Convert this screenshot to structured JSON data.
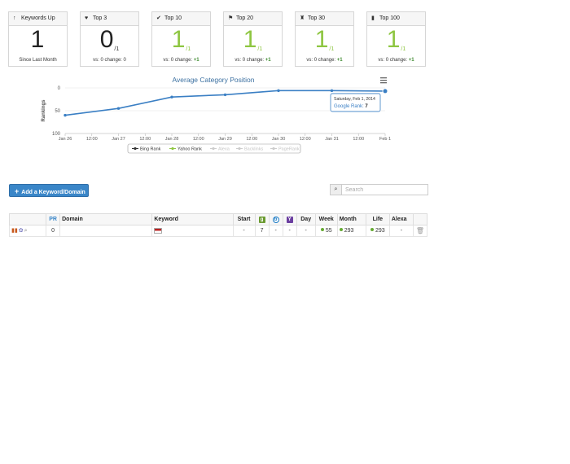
{
  "cards": [
    {
      "icon": "↑",
      "icon_name": "arrow-up-icon",
      "title": "Keywords Up",
      "value": "1",
      "denom": "",
      "footer_prefix": "Since Last Month",
      "footer_change": ""
    },
    {
      "icon": "♥",
      "icon_name": "heart-icon",
      "title": "Top 3",
      "value": "0",
      "denom": "/1",
      "footer_prefix": "vs: 0 change: 0",
      "footer_change": ""
    },
    {
      "icon": "✔",
      "icon_name": "check-icon",
      "title": "Top 10",
      "value": "1",
      "denom": "/1",
      "footer_prefix": "vs: 0 change:",
      "footer_change": "+1"
    },
    {
      "icon": "⚑",
      "icon_name": "bookmark-icon",
      "title": "Top 20",
      "value": "1",
      "denom": "/1",
      "footer_prefix": "vs: 0 change:",
      "footer_change": "+1"
    },
    {
      "icon": "♜",
      "icon_name": "tower-icon",
      "title": "Top 30",
      "value": "1",
      "denom": "/1",
      "footer_prefix": "vs: 0 change:",
      "footer_change": "+1"
    },
    {
      "icon": "▮",
      "icon_name": "bar-chart-icon",
      "title": "Top 100",
      "value": "1",
      "denom": "/1",
      "footer_prefix": "vs: 0 change:",
      "footer_change": "+1"
    }
  ],
  "chart_data": {
    "type": "line",
    "title": "Average Category Position",
    "ylabel": "Rankings",
    "ylim": [
      100,
      0
    ],
    "yticks": [
      "0",
      "50",
      "100"
    ],
    "x_ticks": [
      "Jan 26",
      "12:00",
      "Jan 27",
      "12:00",
      "Jan 28",
      "12:00",
      "Jan 29",
      "12:00",
      "Jan 30",
      "12:00",
      "Jan 31",
      "12:00",
      "Feb 1"
    ],
    "series": [
      {
        "name": "Google Rank",
        "x": [
          "Jan 26",
          "Jan 27",
          "Jan 28",
          "Jan 29",
          "Jan 30",
          "Jan 31",
          "Feb 1"
        ],
        "values": [
          60,
          45,
          20,
          15,
          6,
          6,
          7
        ],
        "color": "#3a7fc4"
      }
    ],
    "legend": [
      {
        "name": "Bing Rank",
        "active": true
      },
      {
        "name": "Yahoo Rank",
        "active": true
      },
      {
        "name": "Alexa",
        "active": false
      },
      {
        "name": "Backlinks",
        "active": false
      },
      {
        "name": "PageRank",
        "active": false
      }
    ],
    "tooltip": {
      "date": "Saturday, Feb 1, 2014",
      "label": "Google Rank:",
      "value": "7"
    }
  },
  "add_button": "Add a Keyword/Domain",
  "search": {
    "placeholder": "Search"
  },
  "table": {
    "headers": {
      "pr": "PR",
      "domain": "Domain",
      "keyword": "Keyword",
      "start": "Start",
      "day": "Day",
      "week": "Week",
      "month": "Month",
      "life": "Life",
      "alexa": "Alexa"
    },
    "row": {
      "pr": "0",
      "start": "-",
      "google": "7",
      "bing": "-",
      "yahoo": "-",
      "day": "-",
      "week": "55",
      "month": "293",
      "life": "293",
      "alexa": "-"
    }
  },
  "colors": {
    "accent": "#3a86c8",
    "green": "#8ec641",
    "line": "#3a7fc4"
  }
}
